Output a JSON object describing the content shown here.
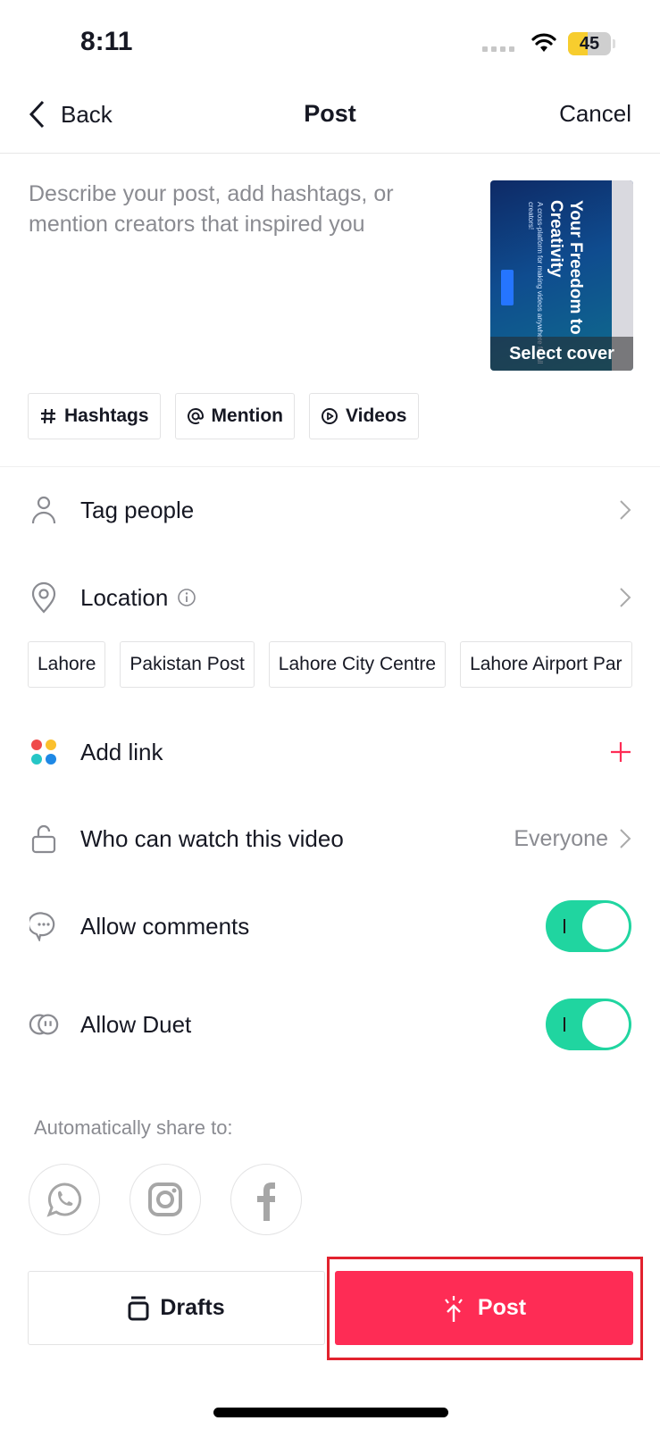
{
  "status_bar": {
    "time": "8:11",
    "battery": "45",
    "battery_level_percent": 45
  },
  "nav": {
    "back_label": "Back",
    "title": "Post",
    "cancel_label": "Cancel"
  },
  "compose": {
    "placeholder": "Describe your post, add hashtags, or mention creators that inspired you",
    "cover": {
      "select_label": "Select cover",
      "headline": "Your Freedom to Creativity",
      "subtext": "A cross-platform for making videos anywhere for all creators!"
    }
  },
  "chips": [
    {
      "icon": "hashtag-icon",
      "label": "Hashtags"
    },
    {
      "icon": "at-icon",
      "label": "Mention"
    },
    {
      "icon": "play-circle-icon",
      "label": "Videos"
    }
  ],
  "rows": {
    "tag_people": {
      "label": "Tag people"
    },
    "location": {
      "label": "Location"
    },
    "add_link": {
      "label": "Add link"
    },
    "visibility": {
      "label": "Who can watch this video",
      "value": "Everyone"
    },
    "allow_comments": {
      "label": "Allow comments",
      "on": true
    },
    "allow_duet": {
      "label": "Allow Duet",
      "on": true
    }
  },
  "location_suggestions": [
    "Lahore",
    "Pakistan Post",
    "Lahore City Centre",
    "Lahore Airport Par"
  ],
  "share": {
    "label": "Automatically share to:",
    "targets": [
      "whatsapp-icon",
      "instagram-icon",
      "facebook-icon"
    ]
  },
  "actions": {
    "drafts_label": "Drafts",
    "post_label": "Post"
  },
  "colors": {
    "accent": "#fe2c55",
    "toggle_on": "#20d5a0",
    "highlight": "#e2222e"
  }
}
